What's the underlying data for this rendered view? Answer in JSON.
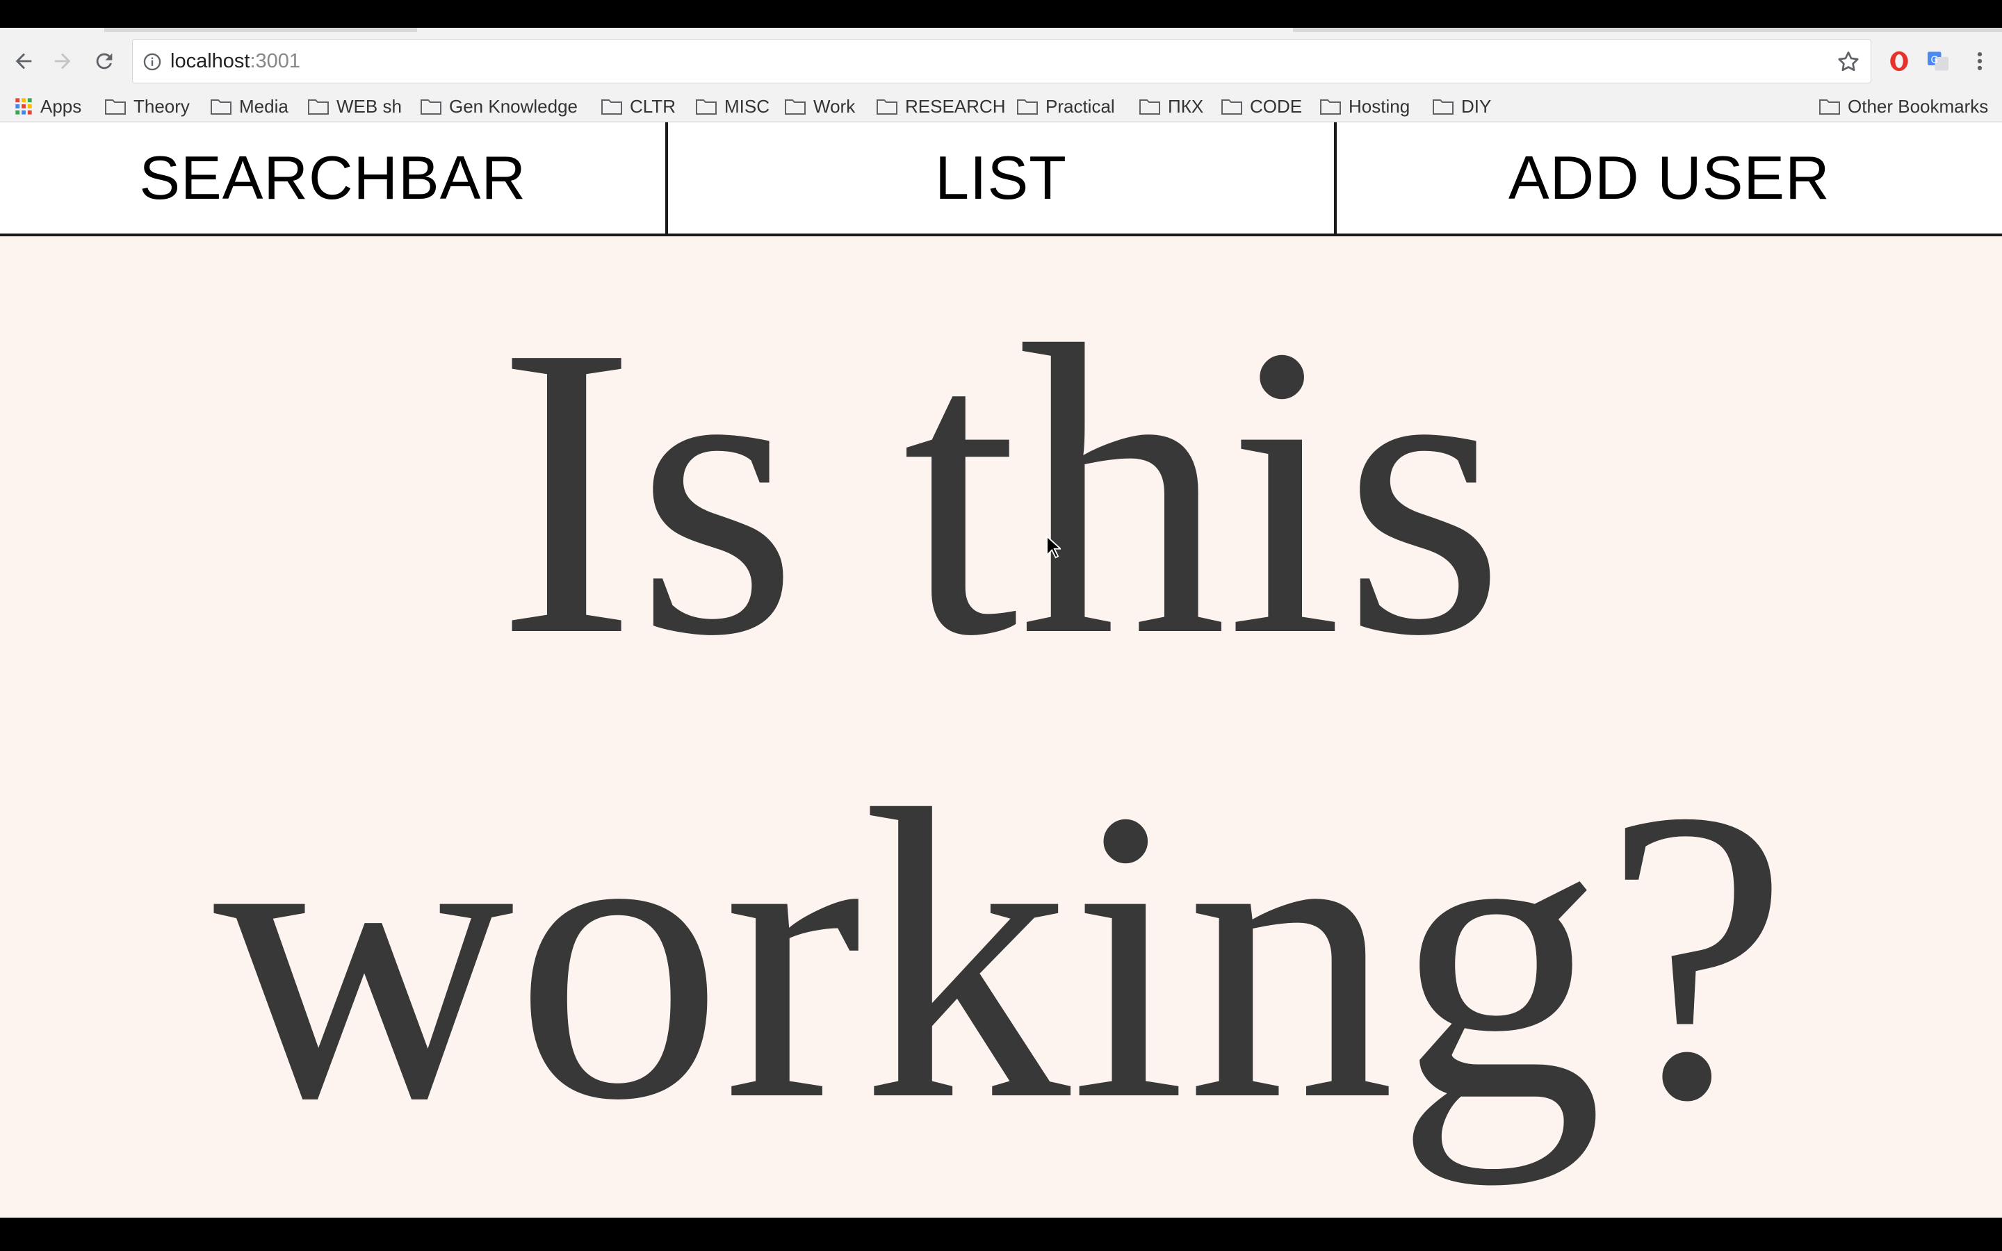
{
  "browser": {
    "url_host": "localhost",
    "url_port": ":3001",
    "nav": {
      "back_icon": "arrow-left-icon",
      "forward_icon": "arrow-right-icon",
      "reload_icon": "reload-icon"
    },
    "extensions": [
      "opera-icon",
      "translate-icon",
      "menu-dots-icon"
    ]
  },
  "bookmarks": {
    "apps_label": "Apps",
    "items": [
      "Theory",
      "Media",
      "WEB sh",
      "Gen Knowledge",
      "CLTR",
      "MISC",
      "Work",
      "RESEARCH",
      "Practical",
      "ПКХ",
      "CODE",
      "Hosting",
      "DIY"
    ],
    "other_label": "Other Bookmarks"
  },
  "app": {
    "tabs": [
      "SEARCHBAR",
      "LIST",
      "ADD USER"
    ],
    "headline": "Is this working?"
  },
  "colors": {
    "content_bg": "#fdf4f0",
    "headline_text": "#383838",
    "header_border": "#1a1a1a"
  }
}
